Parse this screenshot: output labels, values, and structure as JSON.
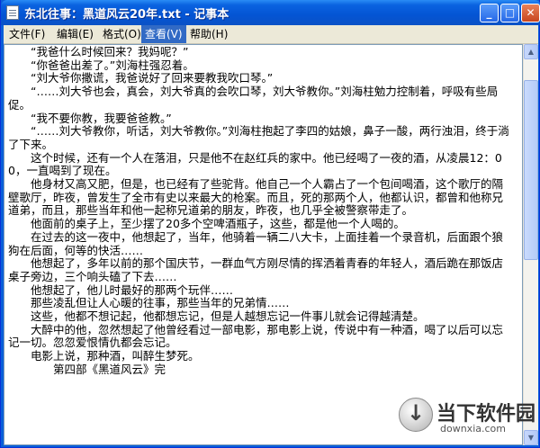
{
  "window": {
    "title": "东北往事：黑道风云20年.txt - 记事本",
    "buttons": {
      "minimize": "_",
      "maximize": "□",
      "close": "✕"
    }
  },
  "menu": {
    "items": [
      "文件(F)",
      "编辑(E)",
      "格式(O)",
      "查看(V)",
      "帮助(H)"
    ],
    "active_index": 3
  },
  "editor": {
    "lines": [
      "　　“我爸什么时候回来？我妈呢？”",
      "　　“你爸爸出差了。”刘海柱强忍着。",
      "　　“刘大爷你撒谎，我爸说好了回来要教我吹口琴。”",
      "　　“……刘大爷也会，真会，刘大爷真的会吹口琴，刘大爷教你。”刘海柱勉力控制着，呼吸有些局促。",
      "　　“我不要你教，我要爸爸教。”",
      "　　“……刘大爷教你，听话，刘大爷教你。”刘海柱抱起了李四的姑娘，鼻子一酸，两行浊泪，终于淌了下来。",
      "　　这个时候，还有一个人在落泪，只是他不在赵红兵的家中。他已经喝了一夜的酒，从凌晨12：00，一直喝到了现在。",
      "　　他身材又高又肥，但是，也已经有了些驼背。他自己一个人霸占了一个包间喝酒，这个歌厅的隔壁歌厅，昨夜，曾发生了全市有史以来最大的枪案。而且，死的那两个人，他都认识，都曾和他称兄道弟，而且，那些当年和他一起称兄道弟的朋友，昨夜，也几乎全被警察带走了。",
      "　　他面前的桌子上，至少摆了20多个空啤酒瓶子，这些，都是他一个人喝的。",
      "　　在过去的这一夜中，他想起了，当年，他骑着一辆二八大卡，上面挂着一个录音机，后面跟个狼狗在后面，何等的快活……",
      "　　他想起了，多年以前的那个国庆节，一群血气方刚尽情的挥洒着青春的年轻人，酒后跪在那饭店桌子旁边，三个响头磕了下去……",
      "　　他想起了，他儿时最好的那两个玩伴……",
      "　　那些凌乱但让人心暖的往事，那些当年的兄弟情……",
      "　　这些，他都不想记起，他都想忘记，但是人越想忘记一件事儿就会记得越清楚。",
      "　　大醉中的他，忽然想起了他曾经看过一部电影，那电影上说，传说中有一种酒，喝了以后可以忘记一切。忽忽爱恨情仇都会忘记。",
      "　　电影上说，那种酒，叫醉生梦死。",
      "　　　　第四部《黑道风云》完"
    ]
  },
  "watermark": {
    "name": "当下软件园",
    "url": "downxia.com"
  }
}
